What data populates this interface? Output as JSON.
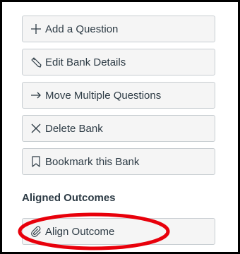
{
  "actions": [
    {
      "label": "Add a Question",
      "icon": "plus-icon"
    },
    {
      "label": "Edit Bank Details",
      "icon": "pencil-icon"
    },
    {
      "label": "Move Multiple Questions",
      "icon": "arrow-right-icon"
    },
    {
      "label": "Delete Bank",
      "icon": "x-icon"
    },
    {
      "label": "Bookmark this Bank",
      "icon": "bookmark-icon"
    }
  ],
  "outcomes": {
    "heading": "Aligned Outcomes",
    "align_button": {
      "label": "Align Outcome",
      "icon": "paperclip-icon"
    }
  },
  "colors": {
    "text": "#2d3b45",
    "button_bg": "#f5f5f5",
    "button_border": "#c7cdd1",
    "highlight": "#e8000b"
  }
}
